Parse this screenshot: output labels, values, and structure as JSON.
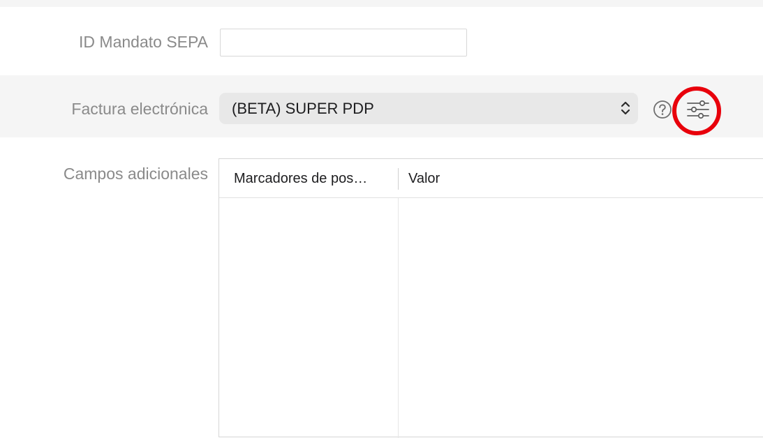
{
  "sepa": {
    "label": "ID Mandato SEPA",
    "value": "",
    "placeholder": ""
  },
  "einvoice": {
    "label": "Factura electrónica",
    "selected": "(BETA) SUPER PDP",
    "help_icon": "question-circle-icon",
    "settings_icon": "sliders-icon"
  },
  "extra_fields": {
    "label": "Campos adicionales",
    "columns": [
      "Marcadores de pos…",
      "Valor"
    ],
    "rows": []
  },
  "colors": {
    "highlight": "#e8000b",
    "band": "#f5f5f5",
    "popup_bg": "#e8e8e8"
  }
}
